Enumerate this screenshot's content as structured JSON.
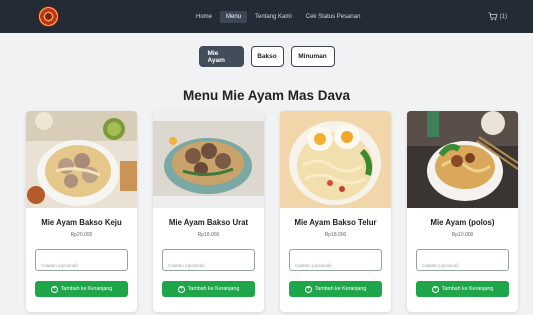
{
  "navbar": {
    "links": [
      {
        "label": "Home"
      },
      {
        "label": "Menu",
        "active": true
      },
      {
        "label": "Tentang Kami"
      },
      {
        "label": "Cek Status Pesanan"
      }
    ],
    "cart_count": "(1)"
  },
  "tabs": [
    {
      "label": "Mie Ayam",
      "active": true
    },
    {
      "label": "Bakso"
    },
    {
      "label": "Minuman"
    }
  ],
  "section_title": "Menu Mie Ayam Mas Dava",
  "products": [
    {
      "name": "Mie Ayam Bakso Keju",
      "price": "Rp20.000",
      "note_placeholder": "Catatan (opsional)",
      "button_label": "Tambah ke Keranjang"
    },
    {
      "name": "Mie Ayam Bakso Urat",
      "price": "Rp18.000",
      "note_placeholder": "Catatan (opsional)",
      "button_label": "Tambah ke Keranjang"
    },
    {
      "name": "Mie Ayam Bakso Telur",
      "price": "Rp18.000",
      "note_placeholder": "Catatan (opsional)",
      "button_label": "Tambah ke Keranjang"
    },
    {
      "name": "Mie Ayam (polos)",
      "price": "Rp10.000",
      "note_placeholder": "Catatan (opsional)",
      "button_label": "Tambah ke Keranjang"
    }
  ],
  "colors": {
    "navbar": "#232b35",
    "accent_button": "#1fa64a",
    "active_tab": "#434c5a"
  }
}
